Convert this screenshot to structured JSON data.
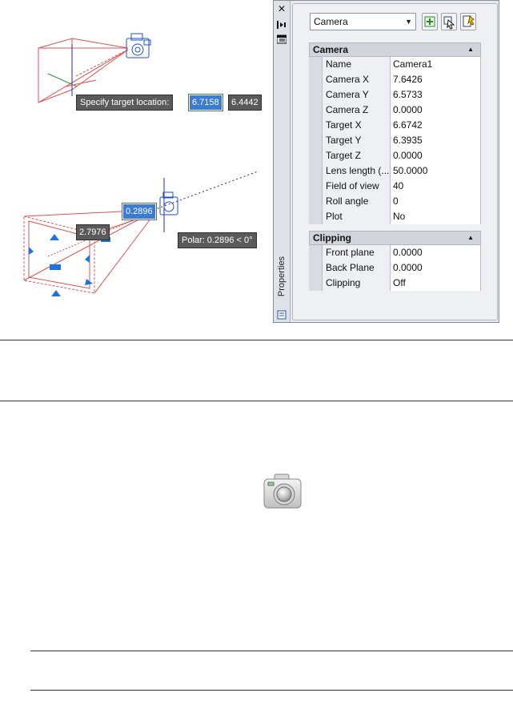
{
  "drawing": {
    "prompt_label": "Specify target location:",
    "target_x_input": "6.7158",
    "target_y_input": "6.4442",
    "distance_input": "0.2896",
    "length_input": "2.7976",
    "polar_tip": "Polar: 0.2896 < 0°"
  },
  "palette": {
    "title": "Properties",
    "close_glyph": "✕",
    "selector": {
      "value": "Camera"
    },
    "categories": [
      {
        "label": "Camera",
        "rows": [
          {
            "name": "Name",
            "value": "Camera1"
          },
          {
            "name": "Camera X",
            "value": "7.6426"
          },
          {
            "name": "Camera Y",
            "value": "6.5733"
          },
          {
            "name": "Camera Z",
            "value": "0.0000"
          },
          {
            "name": "Target X",
            "value": "6.6742"
          },
          {
            "name": "Target Y",
            "value": "6.3935"
          },
          {
            "name": "Target Z",
            "value": "0.0000"
          },
          {
            "name": "Lens length (...",
            "value": "50.0000"
          },
          {
            "name": "Field of view",
            "value": "40"
          },
          {
            "name": "Roll angle",
            "value": "0"
          },
          {
            "name": "Plot",
            "value": "No"
          }
        ]
      },
      {
        "label": "Clipping",
        "rows": [
          {
            "name": "Front plane",
            "value": "0.0000"
          },
          {
            "name": "Back Plane",
            "value": "0.0000"
          },
          {
            "name": "Clipping",
            "value": "Off"
          }
        ]
      }
    ]
  },
  "icons": {
    "camera_tool": "camera-icon"
  }
}
